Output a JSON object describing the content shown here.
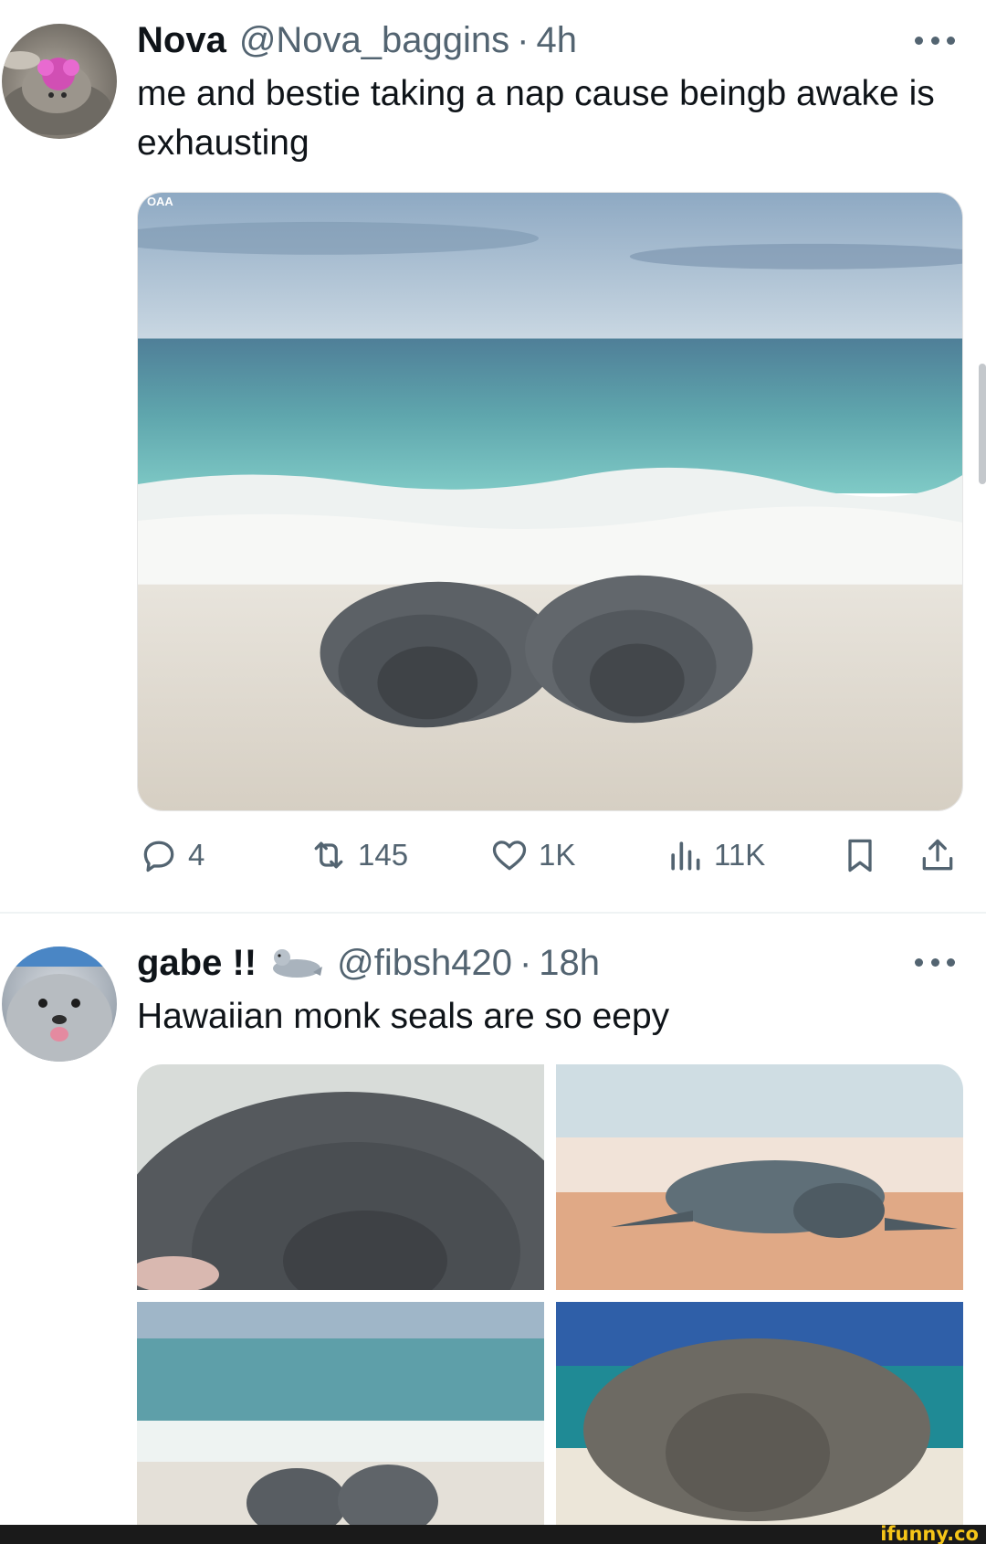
{
  "tweets": [
    {
      "display_name": "Nova",
      "handle": "@Nova_baggins",
      "separator": "·",
      "time": "4h",
      "text": "me and bestie taking a nap cause beingb awake is exhausting",
      "image_label": "OAA",
      "stats": {
        "replies": "4",
        "retweets": "145",
        "likes": "1K",
        "views": "11K"
      }
    },
    {
      "display_name": "gabe !!",
      "handle": "@fibsh420",
      "separator": "·",
      "time": "18h",
      "text": "Hawaiian monk seals are so eepy"
    }
  ],
  "icons": {
    "reply": "reply-icon",
    "retweet": "retweet-icon",
    "like": "heart-icon",
    "views": "views-icon",
    "bookmark": "bookmark-icon",
    "share": "share-icon",
    "more": "more-icon",
    "name_emoji": "seal-emoji-icon"
  },
  "colors": {
    "text": "#0f1419",
    "muted": "#536471",
    "divider": "#eff3f4",
    "watermark": "#f5c518"
  },
  "watermark": "ifunny.co"
}
